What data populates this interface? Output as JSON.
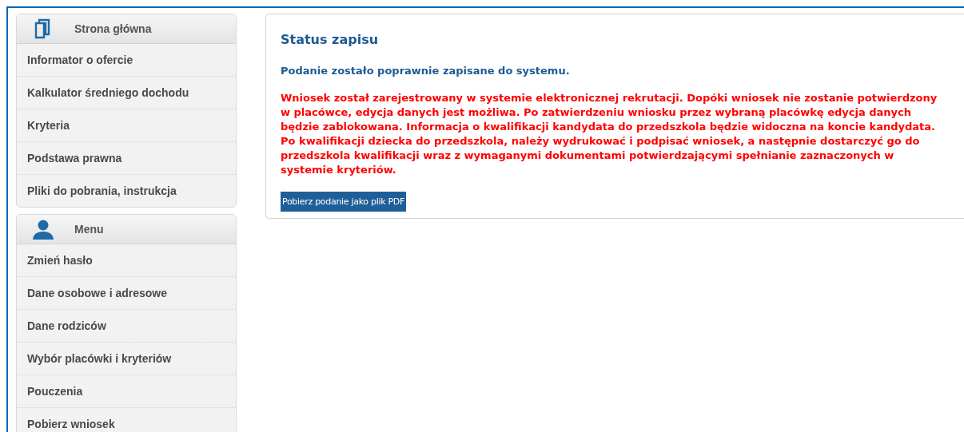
{
  "sidebar": {
    "panels": [
      {
        "title": "Strona główna",
        "items": [
          "Informator o ofercie",
          "Kalkulator średniego dochodu",
          "Kryteria",
          "Podstawa prawna",
          "Pliki do pobrania, instrukcja"
        ]
      },
      {
        "title": "Menu",
        "items": [
          "Zmień hasło",
          "Dane osobowe i adresowe",
          "Dane rodziców",
          "Wybór placówki i kryteriów",
          "Pouczenia",
          "Pobierz wniosek"
        ]
      }
    ]
  },
  "main": {
    "title": "Status zapisu",
    "success": "Podanie zostało poprawnie zapisane do systemu.",
    "warning": "Wniosek został zarejestrowany w systemie elektronicznej rekrutacji. Dopóki wniosek nie zostanie potwierdzony w placówce, edycja danych jest możliwa. Po zatwierdzeniu wniosku przez wybraną placówkę edycja danych będzie zablokowana. Informacja o kwalifikacji kandydata do przedszkola będzie widoczna na koncie kandydata. Po kwalifikacji dziecka do przedszkola, należy wydrukować i podpisać wniosek, a następnie dostarczyć go do przedszkola kwalifikacji wraz z wymaganymi dokumentami potwierdzającymi spełnianie zaznaczonych w systemie kryteriów.",
    "button": "Pobierz podanie jako plik PDF"
  }
}
